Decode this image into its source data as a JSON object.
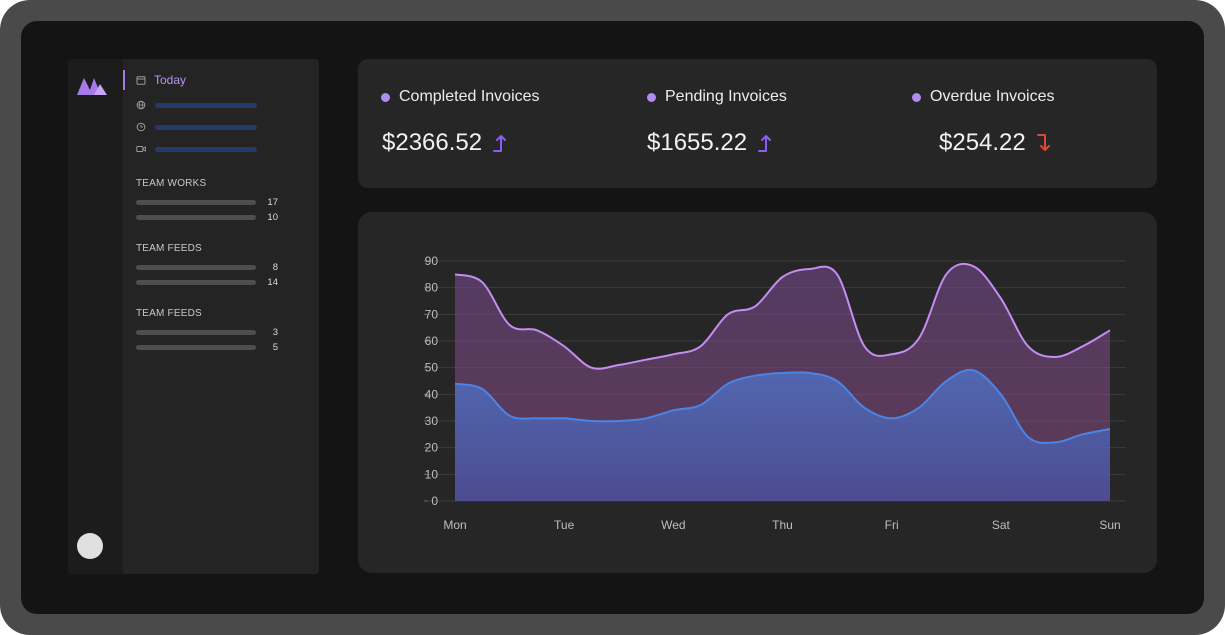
{
  "sidebar": {
    "today_label": "Today",
    "nav_icons": [
      "calendar-icon",
      "globe-icon",
      "clock-icon",
      "video-icon"
    ],
    "sections": [
      {
        "title": "TEAM WORKS",
        "items": [
          {
            "value": "17",
            "progress": 1.0
          },
          {
            "value": "10",
            "progress": 1.0
          }
        ]
      },
      {
        "title": "TEAM FEEDS",
        "items": [
          {
            "value": "8",
            "progress": 1.0
          },
          {
            "value": "14",
            "progress": 1.0
          }
        ]
      },
      {
        "title": "TEAM FEEDS",
        "items": [
          {
            "value": "3",
            "progress": 1.0
          },
          {
            "value": "5",
            "progress": 1.0
          }
        ]
      }
    ]
  },
  "stats": [
    {
      "label": "Completed Invoices",
      "value": "$2366.52",
      "trend": "up",
      "trend_icon": "arrow-up-icon"
    },
    {
      "label": "Pending Invoices",
      "value": "$1655.22",
      "trend": "up",
      "trend_icon": "arrow-up-icon"
    },
    {
      "label": "Overdue Invoices",
      "value": "$254.22",
      "trend": "down",
      "trend_icon": "arrow-down-icon"
    }
  ],
  "colors": {
    "accent": "#a87ae8",
    "trend_up": "#8b5cf6",
    "trend_down": "#e0453a",
    "series_purple": "#c58cf2",
    "series_blue": "#4b84e6",
    "nav_bar": "#243a68"
  },
  "chart_data": {
    "type": "area",
    "categories": [
      "Mon",
      "Tue",
      "Wed",
      "Thu",
      "Fri",
      "Sat",
      "Sun"
    ],
    "ylim": [
      0,
      90
    ],
    "yticks": [
      0,
      10,
      20,
      30,
      40,
      50,
      60,
      70,
      80,
      90
    ],
    "grid": true,
    "series": [
      {
        "color": "#c58cf2",
        "x": [
          0,
          0.25,
          0.5,
          0.75,
          1,
          1.25,
          1.5,
          1.75,
          2,
          2.25,
          2.5,
          2.75,
          3,
          3.25,
          3.5,
          3.75,
          4,
          4.25,
          4.5,
          4.75,
          5,
          5.25,
          5.5,
          5.75,
          6
        ],
        "values": [
          85,
          82,
          66,
          64,
          58,
          50,
          51,
          53,
          55,
          58,
          70,
          73,
          84,
          87,
          85,
          58,
          55,
          61,
          85,
          88,
          76,
          58,
          54,
          58,
          64
        ]
      },
      {
        "color": "#4b84e6",
        "x": [
          0,
          0.25,
          0.5,
          0.75,
          1,
          1.25,
          1.5,
          1.75,
          2,
          2.25,
          2.5,
          2.75,
          3,
          3.25,
          3.5,
          3.75,
          4,
          4.25,
          4.5,
          4.75,
          5,
          5.25,
          5.5,
          5.75,
          6
        ],
        "values": [
          44,
          42,
          32,
          31,
          31,
          30,
          30,
          31,
          34,
          36,
          44,
          47,
          48,
          48,
          45,
          35,
          31,
          35,
          45,
          49,
          40,
          24,
          22,
          25,
          27
        ]
      }
    ]
  }
}
